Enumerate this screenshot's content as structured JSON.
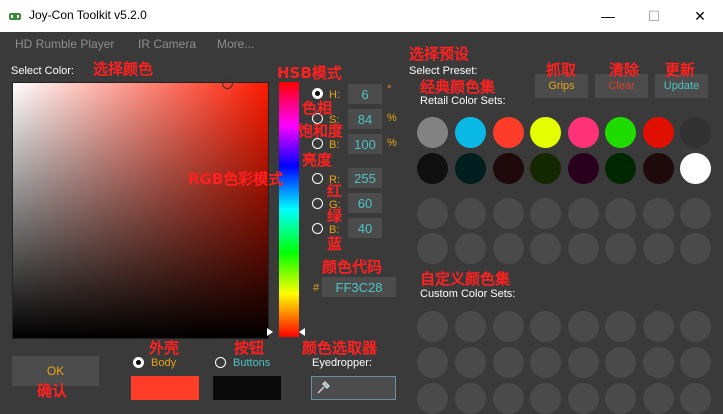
{
  "window": {
    "title": "Joy-Con Toolkit v5.2.0",
    "min_glyph": "—",
    "max_glyph": "☐",
    "close_glyph": "✕"
  },
  "menu": [
    "HD Rumble Player",
    "IR Camera",
    "More..."
  ],
  "labels": {
    "select_color": "Select Color:",
    "select_preset": "Select Preset:",
    "retail_sets": "Retail Color Sets:",
    "custom_sets": "Custom Color Sets:",
    "eyedropper": "Eyedropper:"
  },
  "hsb": {
    "h_label": "H:",
    "h_value": "6",
    "h_unit": "°",
    "s_label": "S:",
    "s_value": "84",
    "s_unit": "%",
    "b_label": "B:",
    "b_value": "100",
    "b_unit": "%"
  },
  "rgb": {
    "r_label": "R:",
    "r_value": "255",
    "g_label": "G:",
    "g_value": "60",
    "b_label": "B:",
    "b_value": "40"
  },
  "hex": {
    "prefix": "#",
    "value": "FF3C28"
  },
  "preset_buttons": {
    "grips": "Grips",
    "clear": "Clear",
    "update": "Update"
  },
  "retail_colors_row1": [
    "#828282",
    "#0ab9e6",
    "#ff3c28",
    "#e6ff00",
    "#ff3278",
    "#1edc00",
    "#e10f00",
    "#323232"
  ],
  "retail_colors_row2": [
    "#0f0f0f",
    "#001e1e",
    "#1e0a0a",
    "#142800",
    "#28001e",
    "#002800",
    "#1e0a0a",
    "#ffffff"
  ],
  "bottom": {
    "ok": "OK",
    "body": "Body",
    "buttons": "Buttons"
  },
  "annotations": {
    "select_color": "选择颜色",
    "hsb_mode": "HSB模式",
    "hue": "色相",
    "saturation": "饱和度",
    "brightness": "亮度",
    "rgb_mode": "RGB色彩模式",
    "red": "红",
    "green": "绿",
    "blue": "蓝",
    "color_code": "颜色代码",
    "select_preset": "选择预设",
    "classic_sets": "经典颜色集",
    "grips": "抓取",
    "clear": "清除",
    "update": "更新",
    "custom_sets": "自定义颜色集",
    "shell": "外壳",
    "buttons": "按钮",
    "color_picker": "颜色选取器",
    "confirm": "确认"
  },
  "colors": {
    "accent_orange": "#e8a317",
    "accent_teal": "#4fc3c3",
    "annotation_red": "#ff2020",
    "current_body": "#ff3c28",
    "current_buttons": "#0a0a0a"
  }
}
